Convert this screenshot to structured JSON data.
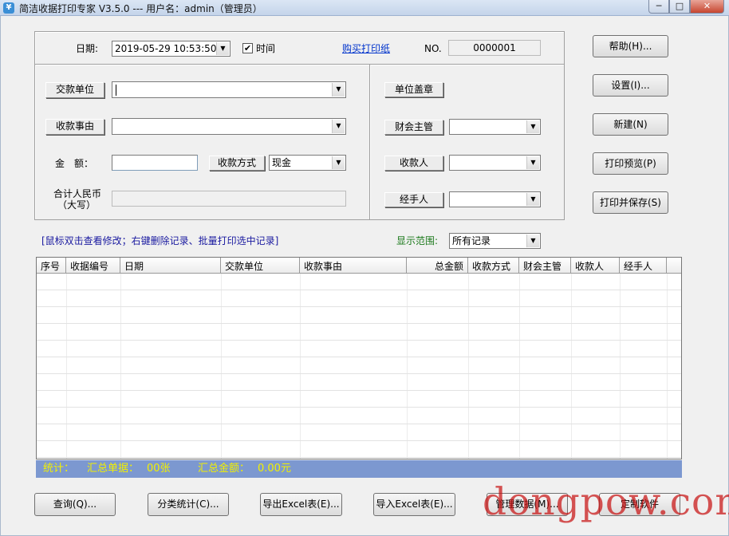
{
  "window": {
    "title": "简洁收据打印专家 V3.5.0 --- 用户名：admin（管理员）",
    "app_icon": "¥",
    "controls": {
      "minimize": "─",
      "maximize": "□",
      "close": "✕"
    }
  },
  "form": {
    "date_label": "日期:",
    "date_value": "2019-05-29 10:53:50",
    "time_checkbox_label": "时间",
    "time_checked": true,
    "buy_link": "购买打印纸",
    "no_label": "NO.",
    "no_value": "0000001",
    "payer_button": "交款单位",
    "payer_value": "",
    "reason_button": "收款事由",
    "reason_value": "",
    "amount_label": "金　额：",
    "amount_value": "",
    "payment_method_button": "收款方式",
    "payment_method_value": "现金",
    "total_rmb_label_line1": "合计人民币",
    "total_rmb_label_line2": "（大写）",
    "total_rmb_value": "",
    "seal_button": "单位盖章",
    "finance_supervisor_button": "财会主管",
    "finance_supervisor_value": "",
    "payee_button": "收款人",
    "payee_value": "",
    "handler_button": "经手人",
    "handler_value": ""
  },
  "side_buttons": [
    "帮助(H)...",
    "设置(I)...",
    "新建(N)",
    "打印预览(P)",
    "打印并保存(S)"
  ],
  "list": {
    "hint": "[鼠标双击查看修改；右键删除记录、批量打印选中记录]",
    "range_label": "显示范围:",
    "range_value": "所有记录",
    "columns": [
      "序号",
      "收据编号",
      "日期",
      "交款单位",
      "收款事由",
      "总金额",
      "收款方式",
      "财会主管",
      "收款人",
      "经手人"
    ],
    "rows": []
  },
  "status": {
    "label": "统计：",
    "count_label": "汇总单据：",
    "count_value": "00张",
    "sum_label": "汇总金额：",
    "sum_value": "0.00元"
  },
  "bottom_buttons": [
    "查询(Q)...",
    "分类统计(C)...",
    "导出Excel表(E)...",
    "导入Excel表(E)...",
    "管理数据(M)...",
    "定制软件"
  ],
  "watermark": "dongpow.com",
  "colors": {
    "status_bar": "#7c98d0",
    "status_text": "#f3f000",
    "link": "#0033cc",
    "hint": "#1a1aa0",
    "range_label": "#1c7a1c",
    "watermark": "#c81414"
  }
}
